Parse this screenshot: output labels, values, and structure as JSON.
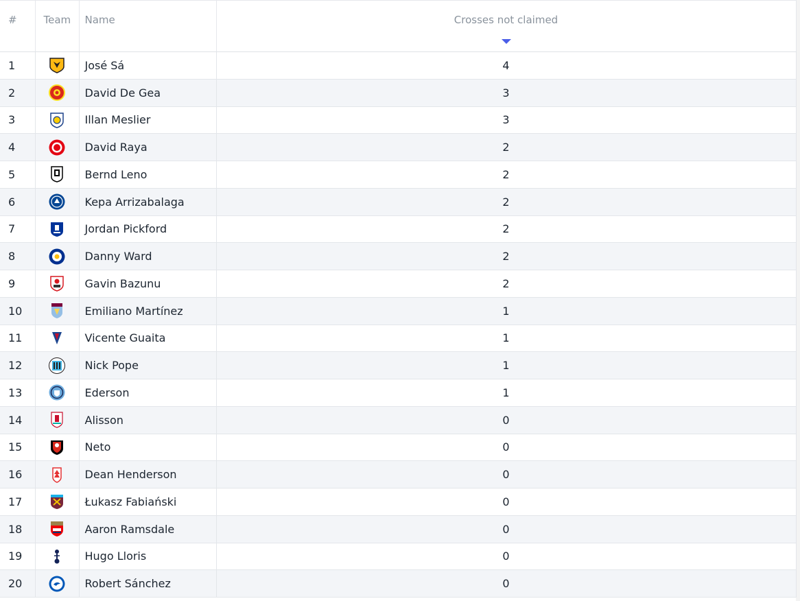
{
  "table": {
    "headers": {
      "rank": "#",
      "team": "Team",
      "name": "Name",
      "value": "Crosses not claimed"
    },
    "sort": {
      "column": "value",
      "direction": "descending"
    },
    "rows": [
      {
        "rank": "1",
        "team_icon": "wolves-crest-icon",
        "colors": [
          "#231f20",
          "#fdb913"
        ],
        "name": "José Sá",
        "value": "4"
      },
      {
        "rank": "2",
        "team_icon": "man-utd-crest-icon",
        "colors": [
          "#da291c",
          "#fbe122"
        ],
        "name": "David De Gea",
        "value": "3"
      },
      {
        "rank": "3",
        "team_icon": "leeds-crest-icon",
        "colors": [
          "#ffcd00",
          "#1d428a"
        ],
        "name": "Illan Meslier",
        "value": "3"
      },
      {
        "rank": "4",
        "team_icon": "brentford-crest-icon",
        "colors": [
          "#e30613",
          "#ffffff"
        ],
        "name": "David Raya",
        "value": "2"
      },
      {
        "rank": "5",
        "team_icon": "fulham-crest-icon",
        "colors": [
          "#ffffff",
          "#000000"
        ],
        "name": "Bernd Leno",
        "value": "2"
      },
      {
        "rank": "6",
        "team_icon": "chelsea-crest-icon",
        "colors": [
          "#034694",
          "#ffffff"
        ],
        "name": "Kepa Arrizabalaga",
        "value": "2"
      },
      {
        "rank": "7",
        "team_icon": "everton-crest-icon",
        "colors": [
          "#003399",
          "#ffffff"
        ],
        "name": "Jordan Pickford",
        "value": "2"
      },
      {
        "rank": "8",
        "team_icon": "leicester-crest-icon",
        "colors": [
          "#003090",
          "#fdbe11"
        ],
        "name": "Danny Ward",
        "value": "2"
      },
      {
        "rank": "9",
        "team_icon": "southampton-crest-icon",
        "colors": [
          "#d71920",
          "#ffffff"
        ],
        "name": "Gavin Bazunu",
        "value": "2"
      },
      {
        "rank": "10",
        "team_icon": "aston-villa-crest-icon",
        "colors": [
          "#95bfe5",
          "#f5d35a"
        ],
        "name": "Emiliano Martínez",
        "value": "1"
      },
      {
        "rank": "11",
        "team_icon": "crystal-palace-crest-icon",
        "colors": [
          "#1b458f",
          "#c4122e"
        ],
        "name": "Vicente Guaita",
        "value": "1"
      },
      {
        "rank": "12",
        "team_icon": "newcastle-crest-icon",
        "colors": [
          "#241f20",
          "#41b6e6"
        ],
        "name": "Nick Pope",
        "value": "1"
      },
      {
        "rank": "13",
        "team_icon": "man-city-crest-icon",
        "colors": [
          "#6cabdd",
          "#1c2c5b"
        ],
        "name": "Ederson",
        "value": "1"
      },
      {
        "rank": "14",
        "team_icon": "liverpool-crest-icon",
        "colors": [
          "#c8102e",
          "#00b2a9"
        ],
        "name": "Alisson",
        "value": "0"
      },
      {
        "rank": "15",
        "team_icon": "bournemouth-crest-icon",
        "colors": [
          "#da291c",
          "#000000"
        ],
        "name": "Neto",
        "value": "0"
      },
      {
        "rank": "16",
        "team_icon": "nottingham-forest-crest-icon",
        "colors": [
          "#e53233",
          "#ffffff"
        ],
        "name": "Dean Henderson",
        "value": "0"
      },
      {
        "rank": "17",
        "team_icon": "west-ham-crest-icon",
        "colors": [
          "#7a263a",
          "#1bb1e7"
        ],
        "name": "Łukasz Fabiański",
        "value": "0"
      },
      {
        "rank": "18",
        "team_icon": "arsenal-crest-icon",
        "colors": [
          "#ef0107",
          "#023474"
        ],
        "name": "Aaron Ramsdale",
        "value": "0"
      },
      {
        "rank": "19",
        "team_icon": "tottenham-crest-icon",
        "colors": [
          "#132257",
          "#ffffff"
        ],
        "name": "Hugo Lloris",
        "value": "0"
      },
      {
        "rank": "20",
        "team_icon": "brighton-crest-icon",
        "colors": [
          "#0057b8",
          "#ffffff"
        ],
        "name": "Robert Sánchez",
        "value": "0"
      }
    ]
  }
}
